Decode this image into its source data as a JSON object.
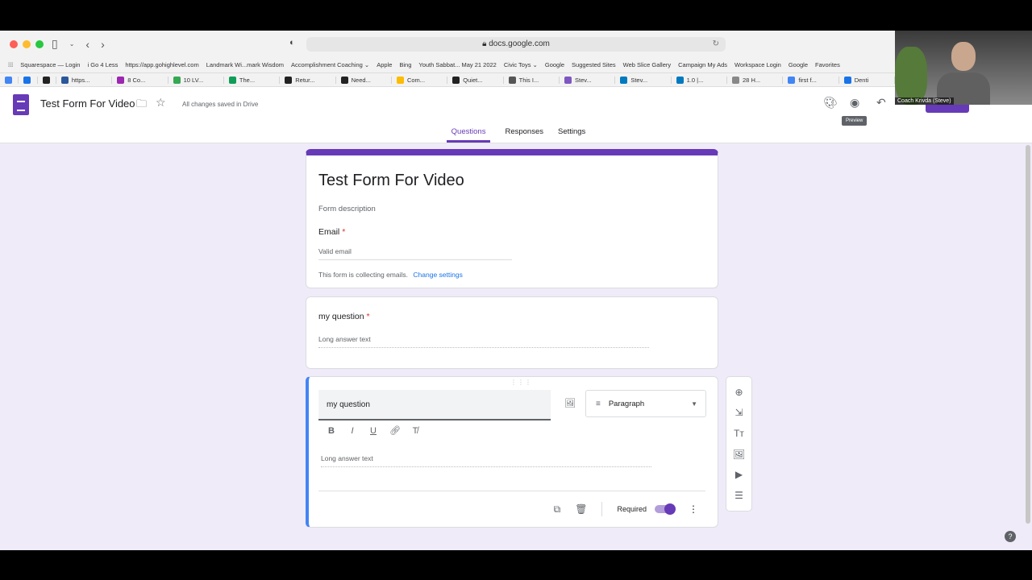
{
  "browser": {
    "url": "docs.google.com",
    "bookmarks": [
      "Squarespace — Login",
      "i Go 4 Less",
      "https://app.gohighlevel.com",
      "Landmark Wi...mark Wisdom",
      "Accomplishment Coaching ⌄",
      "Apple",
      "Bing",
      "Youth Sabbat... May 21 2022",
      "Civic Toys ⌄",
      "Google",
      "Suggested Sites",
      "Web Slice Gallery",
      "Campaign My Ads",
      "Workspace Login",
      "Google",
      "Favorites"
    ],
    "tabs": [
      {
        "label": "",
        "color": "#4285f4"
      },
      {
        "label": "",
        "color": "#1a73e8"
      },
      {
        "label": "",
        "color": "#222222"
      },
      {
        "label": "https...",
        "color": "#2b579a"
      },
      {
        "label": "8 Co...",
        "color": "#9c27b0"
      },
      {
        "label": "10 LV...",
        "color": "#34a853"
      },
      {
        "label": "The...",
        "color": "#0f9d58"
      },
      {
        "label": "Retur...",
        "color": "#222222"
      },
      {
        "label": "Need...",
        "color": "#222222"
      },
      {
        "label": "Com...",
        "color": "#fbbc04"
      },
      {
        "label": "Quiet...",
        "color": "#222222"
      },
      {
        "label": "This I...",
        "color": "#555555"
      },
      {
        "label": "Stev...",
        "color": "#7e57c2"
      },
      {
        "label": "Stev...",
        "color": "#0079bf"
      },
      {
        "label": "1.0 |...",
        "color": "#0079bf"
      },
      {
        "label": "28 H...",
        "color": "#888888"
      },
      {
        "label": "first f...",
        "color": "#4285f4"
      },
      {
        "label": "Denti",
        "color": "#1a73e8"
      }
    ]
  },
  "header": {
    "doc_title": "Test Form For Video",
    "save_status": "All changes saved in Drive",
    "tooltip": "Preview",
    "webcam_label": "Coach Krivda (Steve)"
  },
  "tabs": {
    "questions": "Questions",
    "responses": "Responses",
    "settings": "Settings"
  },
  "form": {
    "title": "Test Form For Video",
    "description_placeholder": "Form description",
    "email_label": "Email",
    "email_placeholder": "Valid email",
    "collecting_text": "This form is collecting emails.",
    "change_settings": "Change settings"
  },
  "question1": {
    "label": "my question",
    "answer_placeholder": "Long answer text"
  },
  "question2": {
    "title_value": "my question",
    "type": "Paragraph",
    "answer_placeholder": "Long answer text",
    "required_label": "Required",
    "required": true
  }
}
